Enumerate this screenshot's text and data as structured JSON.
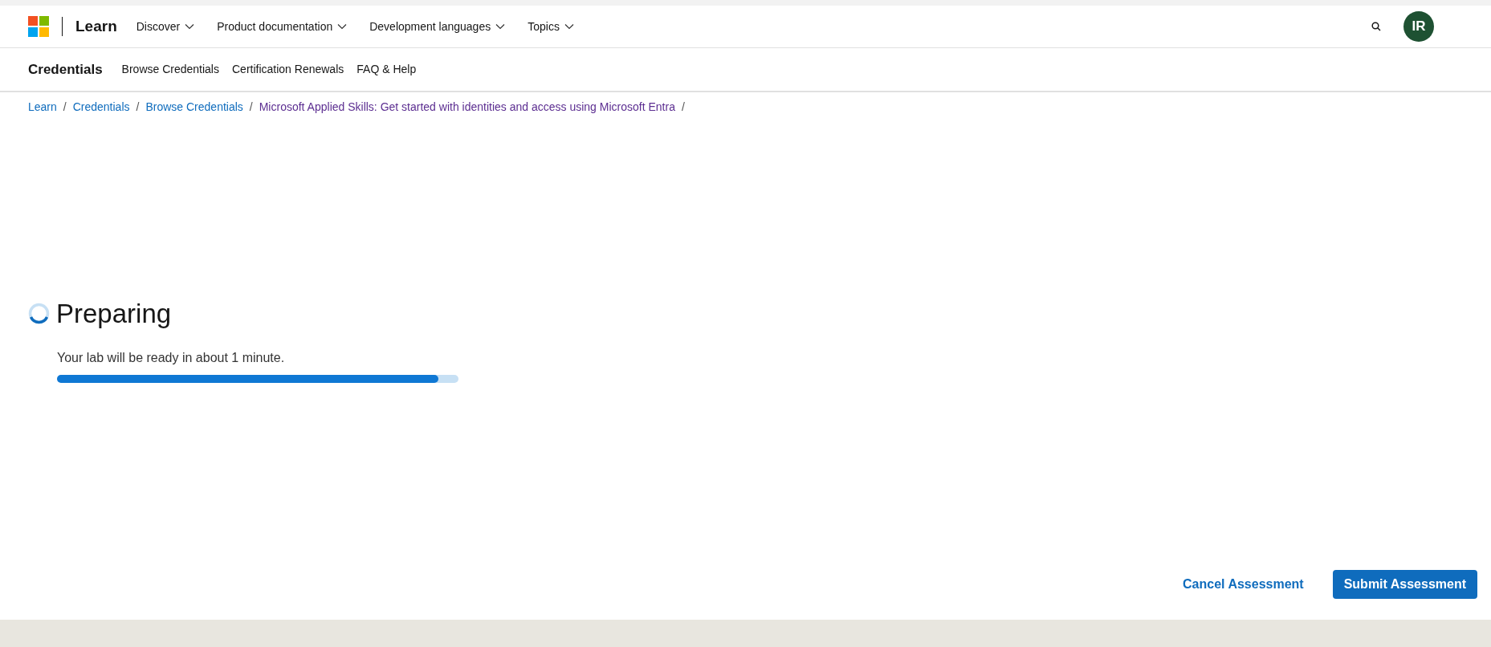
{
  "header": {
    "brand": "Learn",
    "menus": [
      {
        "label": "Discover"
      },
      {
        "label": "Product documentation"
      },
      {
        "label": "Development languages"
      },
      {
        "label": "Topics"
      }
    ],
    "avatar": "IR"
  },
  "subnav": {
    "title": "Credentials",
    "links": [
      "Browse Credentials",
      "Certification Renewals",
      "FAQ & Help"
    ]
  },
  "breadcrumb": [
    {
      "label": "Learn",
      "visited": false
    },
    {
      "label": "Credentials",
      "visited": false
    },
    {
      "label": "Browse Credentials",
      "visited": false
    },
    {
      "label": "Microsoft Applied Skills: Get started with identities and access using Microsoft Entra",
      "visited": true
    }
  ],
  "breadcrumb_separator": "/",
  "status": {
    "title": "Preparing",
    "message": "Your lab will be ready in about 1 minute.",
    "level": 0.95
  },
  "actions": {
    "cancel": "Cancel Assessment",
    "submit": "Submit Assessment"
  }
}
